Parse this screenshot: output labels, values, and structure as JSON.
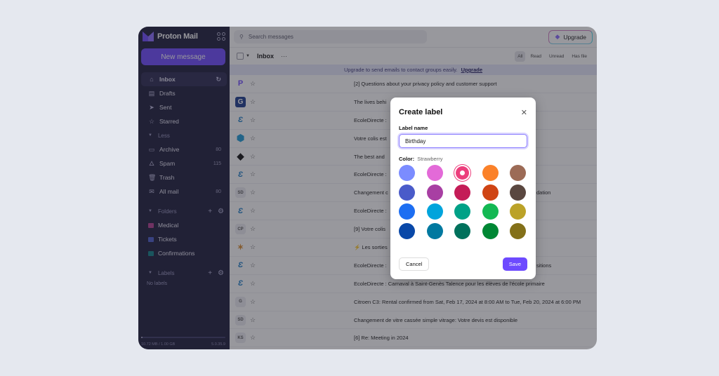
{
  "app": {
    "name": "Proton Mail"
  },
  "sidebar": {
    "new_message": "New message",
    "items": [
      {
        "label": "Inbox",
        "icon": "inbox-icon",
        "count": "",
        "active": true
      },
      {
        "label": "Drafts",
        "icon": "drafts-icon",
        "count": ""
      },
      {
        "label": "Sent",
        "icon": "sent-icon",
        "count": ""
      },
      {
        "label": "Starred",
        "icon": "star-icon",
        "count": ""
      }
    ],
    "less_label": "Less",
    "more_items": [
      {
        "label": "Archive",
        "icon": "archive-icon",
        "count": "80"
      },
      {
        "label": "Spam",
        "icon": "spam-icon",
        "count": "115"
      },
      {
        "label": "Trash",
        "icon": "trash-icon",
        "count": ""
      },
      {
        "label": "All mail",
        "icon": "all-mail-icon",
        "count": "80"
      }
    ],
    "folders_label": "Folders",
    "folders": [
      {
        "label": "Medical",
        "color": "#b03d8e"
      },
      {
        "label": "Tickets",
        "color": "#4a5bc9"
      },
      {
        "label": "Confirmations",
        "color": "#0f7f86"
      }
    ],
    "labels_label": "Labels",
    "no_labels": "No labels",
    "storage": {
      "used": "10.72 MB / 1.00 GB",
      "version": "5.0.35.9",
      "fraction": 0.01
    }
  },
  "topbar": {
    "search_placeholder": "Search messages",
    "upgrade": "Upgrade"
  },
  "toolbar": {
    "title": "Inbox",
    "more": "···",
    "filters": [
      "All",
      "Read",
      "Unread",
      "Has file"
    ],
    "active_filter": "All"
  },
  "banner": {
    "text": "Upgrade to send emails to contact groups easily.",
    "link": "Upgrade"
  },
  "messages": [
    {
      "avatar": "P",
      "avatar_type": "logo-proton",
      "subject": "[2] Questions about your privacy policy and customer support"
    },
    {
      "avatar": "G",
      "avatar_type": "logo-g",
      "subject": "The lives behi"
    },
    {
      "avatar": "E",
      "avatar_type": "logo-ecole",
      "subject": "EcoleDirecte :"
    },
    {
      "avatar": "",
      "avatar_type": "logo-box",
      "subject": "Votre colis est"
    },
    {
      "avatar": "",
      "avatar_type": "logo-diamond",
      "subject": "The best and"
    },
    {
      "avatar": "E",
      "avatar_type": "logo-ecole",
      "subject": "EcoleDirecte :"
    },
    {
      "avatar": "SD",
      "avatar_type": "initials",
      "subject": "Changement c",
      "tail": "dation"
    },
    {
      "avatar": "E",
      "avatar_type": "logo-ecole",
      "subject": "EcoleDirecte :"
    },
    {
      "avatar": "CP",
      "avatar_type": "initials",
      "subject": "[9] Votre colis"
    },
    {
      "avatar": "",
      "avatar_type": "logo-feather",
      "subject": "⚡ Les sorties"
    },
    {
      "avatar": "E",
      "avatar_type": "logo-ecole",
      "subject": "EcoleDirecte :",
      "tail": "sitions"
    },
    {
      "avatar": "E",
      "avatar_type": "logo-ecole",
      "subject": "EcoleDirecte : Carnaval à Saint-Genès Talence pour les élèves de l'école primaire"
    },
    {
      "avatar": "G",
      "avatar_type": "initials",
      "subject": "Citroen C3: Rental confirmed from Sat, Feb 17, 2024 at 8:00 AM to Tue, Feb 20, 2024 at 6:00 PM"
    },
    {
      "avatar": "SD",
      "avatar_type": "initials",
      "subject": "Changement de vitre cassée simple vitrage: Votre devis est disponible"
    },
    {
      "avatar": "KS",
      "avatar_type": "initials",
      "subject": "[6] Re: Meeting in 2024"
    }
  ],
  "modal": {
    "title": "Create label",
    "name_label": "Label name",
    "name_value": "Birthday",
    "color_label": "Color:",
    "color_name": "Strawberry",
    "colors": [
      "#7b8cff",
      "#e36ad8",
      "#ec3e7c",
      "#fb8129",
      "#9c6b56",
      "#4a5bc9",
      "#a83fa3",
      "#c41c57",
      "#cf4414",
      "#5a4740",
      "#1d6ef2",
      "#00a4dc",
      "#00a187",
      "#14b853",
      "#bba228",
      "#0948a8",
      "#0079a0",
      "#00715c",
      "#008734",
      "#837019"
    ],
    "selected_index": 2,
    "cancel": "Cancel",
    "save": "Save"
  }
}
